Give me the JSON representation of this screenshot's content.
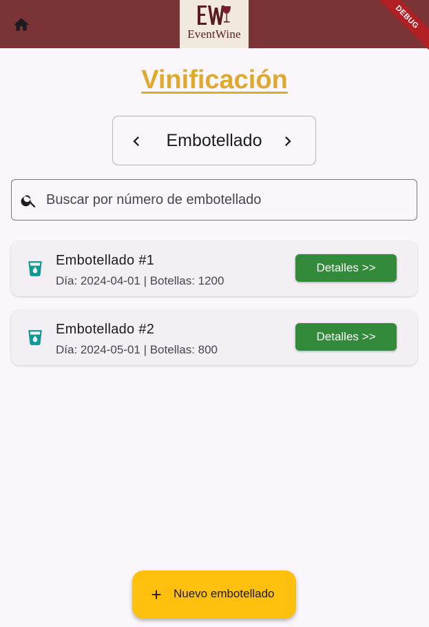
{
  "appbar": {
    "logo_text": "EventWine",
    "logo_monogram": "EW",
    "debug_label": "DEBUG",
    "home_icon": "home-icon"
  },
  "page": {
    "title": "Vinificación"
  },
  "selector": {
    "label": "Embotellado",
    "prev_icon": "chevron-left-icon",
    "next_icon": "chevron-right-icon"
  },
  "search": {
    "placeholder": "Buscar por número de embotellado",
    "value": ""
  },
  "items": [
    {
      "title": "Embotellado #1",
      "subtitle": "Día: 2024-04-01 | Botellas: 1200",
      "button": "Detalles >>"
    },
    {
      "title": "Embotellado #2",
      "subtitle": "Día: 2024-05-01 | Botellas: 800",
      "button": "Detalles >>"
    }
  ],
  "fab": {
    "label": "Nuevo embotellado",
    "icon": "plus-icon"
  },
  "colors": {
    "appbar": "#7a3437",
    "title": "#e0a82c",
    "detail_button": "#338a3a",
    "fab": "#fec00c",
    "item_icon": "#0e9a92"
  }
}
